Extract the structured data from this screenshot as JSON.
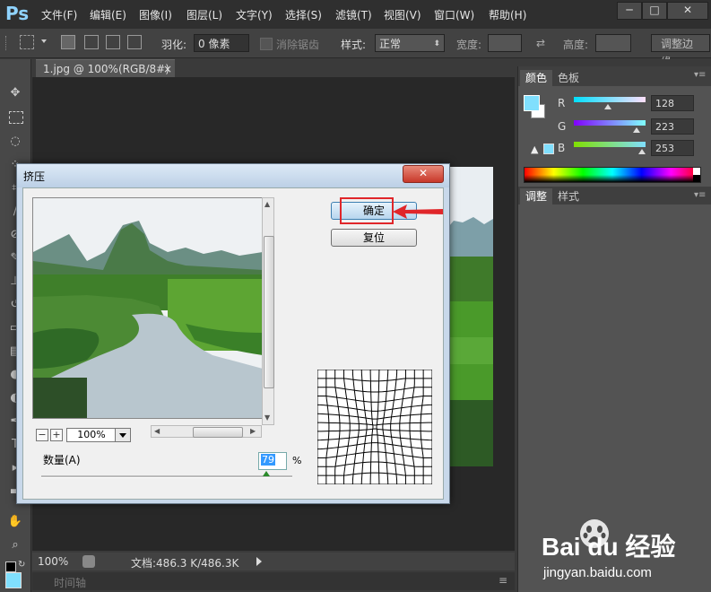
{
  "app": {
    "logo": "Ps"
  },
  "menu": [
    "文件(F)",
    "编辑(E)",
    "图像(I)",
    "图层(L)",
    "文字(Y)",
    "选择(S)",
    "滤镜(T)",
    "视图(V)",
    "窗口(W)",
    "帮助(H)"
  ],
  "window_controls": {
    "minimize": "─",
    "maximize": "□",
    "close": "✕"
  },
  "options": {
    "feather_label": "羽化:",
    "feather_value": "0 像素",
    "antialias_label": "消除锯齿",
    "style_label": "样式:",
    "style_value": "正常",
    "width_label": "宽度:",
    "height_label": "高度:",
    "refine_edge": "调整边缘..."
  },
  "document": {
    "tab_title": "1.jpg @ 100%(RGB/8#)",
    "tab_close": "×",
    "zoom": "100%",
    "doc_info": "文档:486.3 K/486.3K",
    "timeline_label": "时间轴"
  },
  "color_panel": {
    "tabs": [
      "颜色",
      "色板"
    ],
    "r_label": "R",
    "r_value": "128",
    "g_label": "G",
    "g_value": "223",
    "b_label": "B",
    "b_value": "253",
    "fg_color": "#80dffd"
  },
  "adjust_panel": {
    "tabs": [
      "调整",
      "样式"
    ]
  },
  "dialog": {
    "title": "挤压",
    "close": "✕",
    "ok": "确定",
    "reset": "复位",
    "zoom_value": "100%",
    "zoom_minus": "−",
    "zoom_plus": "+",
    "amount_label": "数量(A)",
    "amount_value": "79",
    "percent": "%",
    "amount_fraction": 0.79
  },
  "watermark": {
    "text": "Bai du 经验",
    "url": "jingyan.baidu.com"
  }
}
